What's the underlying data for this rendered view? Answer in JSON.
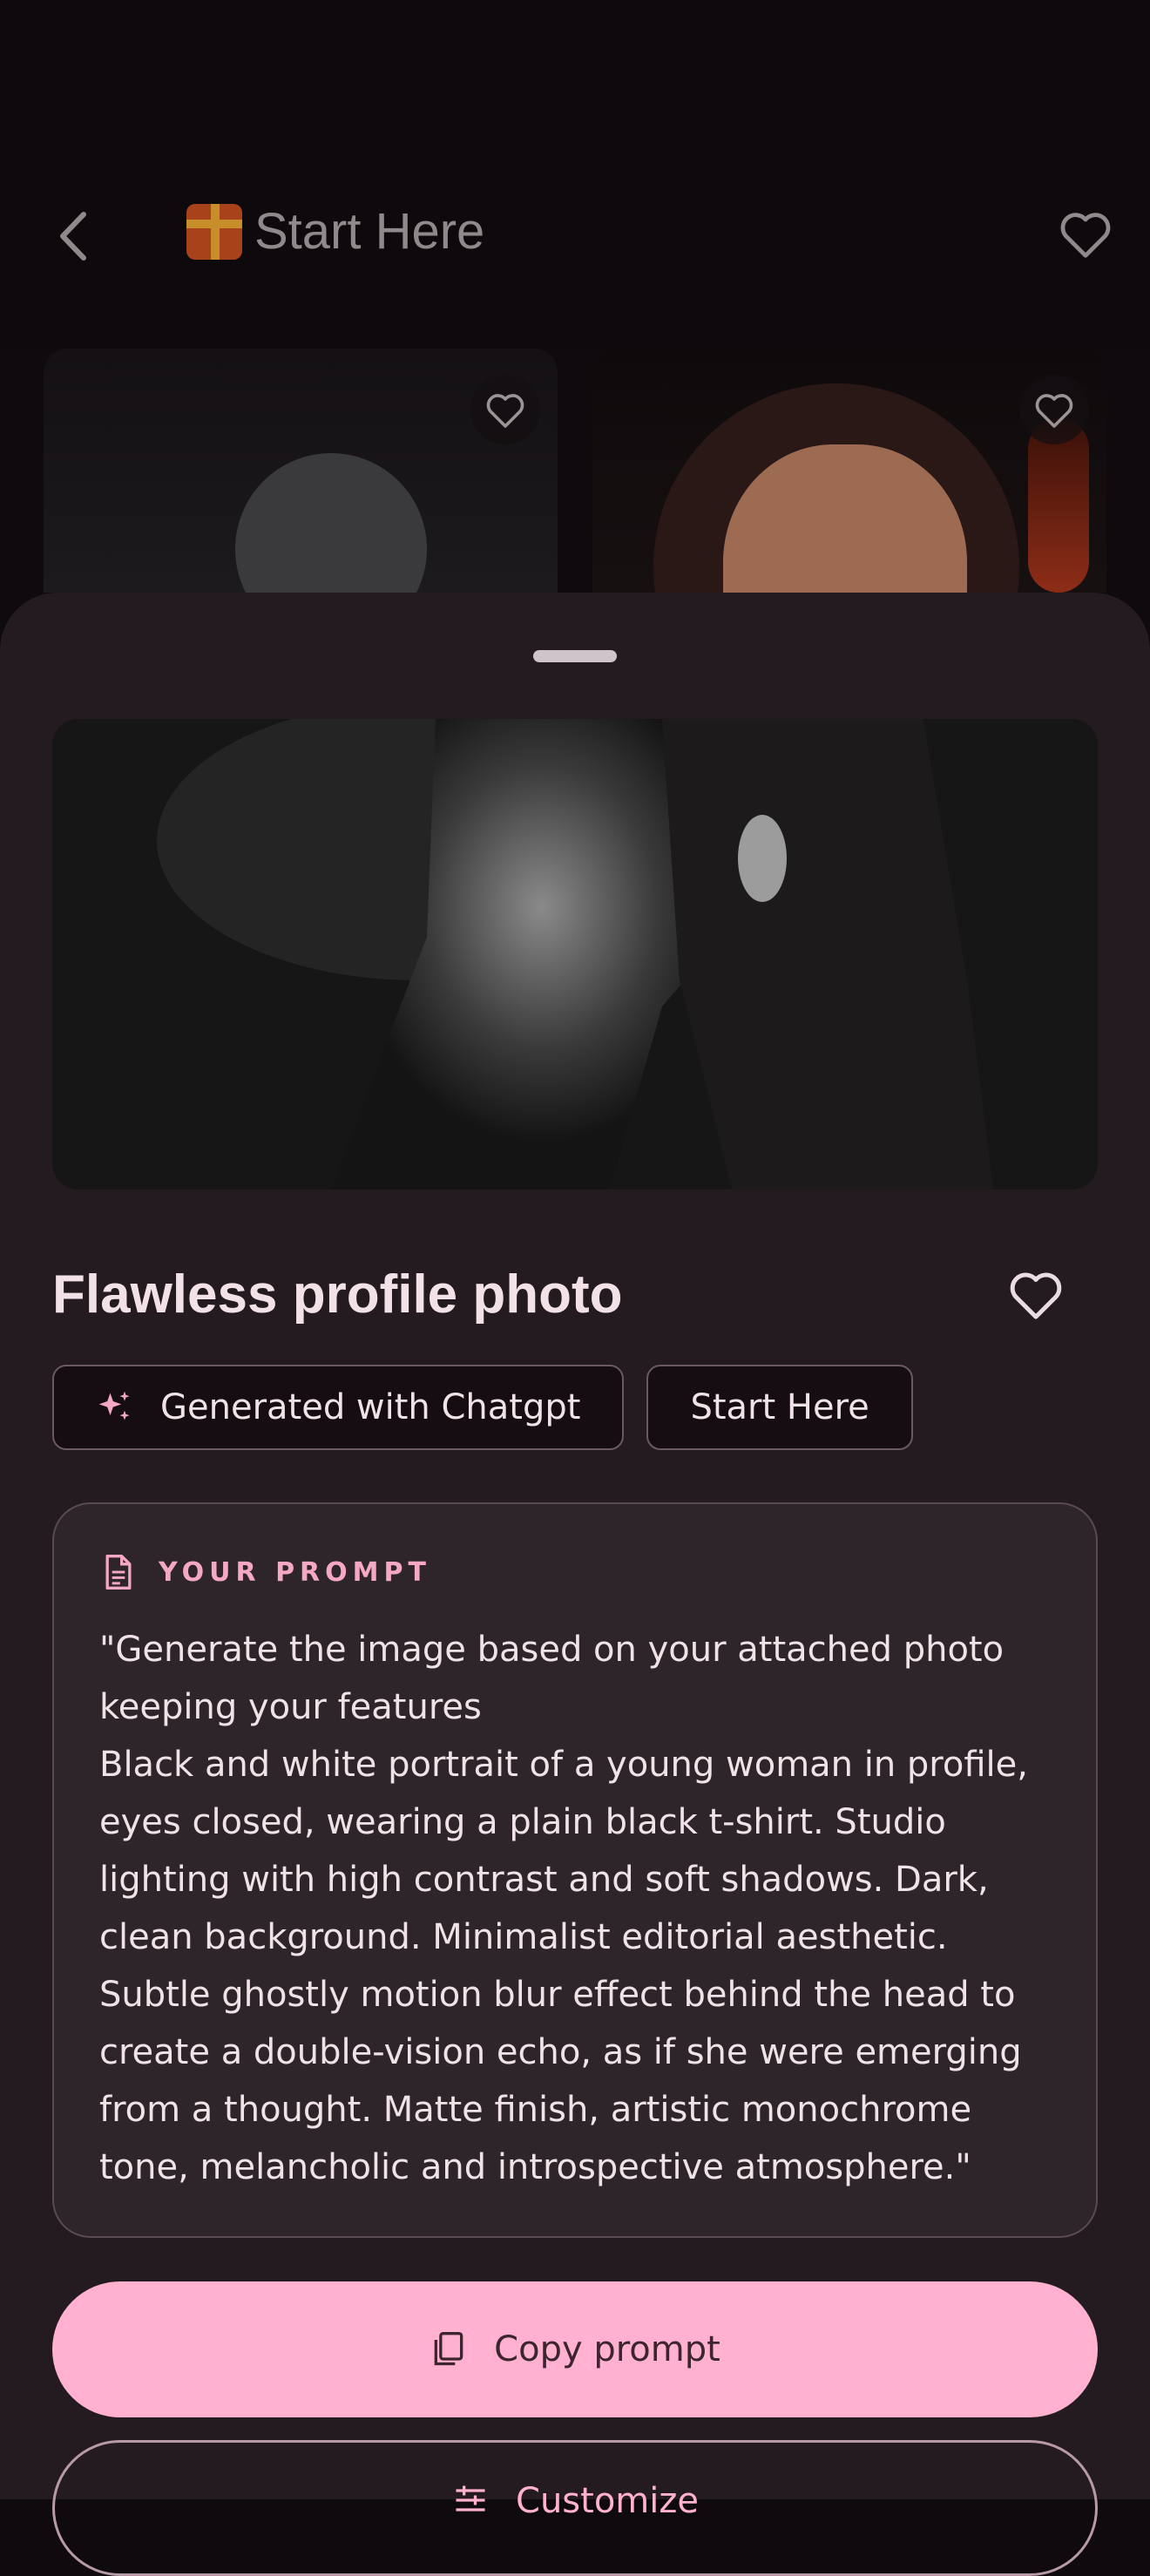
{
  "header": {
    "title": "Start Here",
    "icons": {
      "back": "back-arrow-icon",
      "gift": "gift-icon",
      "favorite": "heart-outline-icon"
    }
  },
  "gallery": [
    {
      "image": "black-and-white-profile-portrait",
      "favorite_icon": "heart-outline-icon"
    },
    {
      "image": "cartoon-woman-angry-portrait",
      "favorite_icon": "heart-outline-icon"
    }
  ],
  "sheet": {
    "title": "Flawless profile photo",
    "hero_image": "black-and-white-woman-profile",
    "tags": [
      "Generated with Chatgpt",
      "Start Here"
    ],
    "prompt_label": "YOUR PROMPT",
    "prompt_text": "\"Generate the image based on your attached photo keeping your features\nBlack and white portrait of a young woman in profile, eyes closed, wearing a plain black t-shirt. Studio lighting with high contrast and soft shadows. Dark, clean background. Minimalist editorial aesthetic. Subtle ghostly motion blur effect behind the head to create a double-vision echo, as if she were emerging from a thought. Matte finish, artistic monochrome tone, melancholic and introspective atmosphere.\"",
    "copy_button": "Copy prompt",
    "customize_button": "Customize"
  },
  "colors": {
    "accent": "#ffb1cf",
    "sheet_bg": "#231b1f",
    "card_bg": "#2d2529"
  }
}
